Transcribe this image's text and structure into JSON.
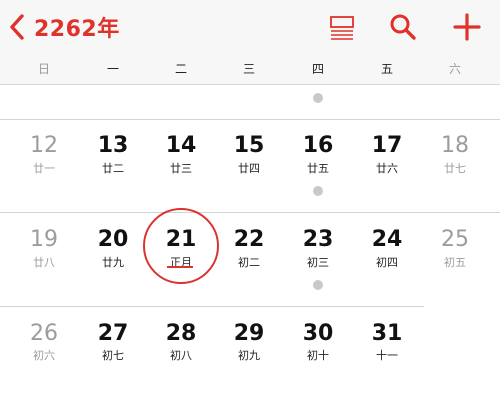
{
  "header": {
    "back_label": "2262年",
    "icons": {
      "list": "list-view-icon",
      "search": "search-icon",
      "add": "plus-icon"
    },
    "accent_color": "#e0312a"
  },
  "weekdays": [
    "日",
    "一",
    "二",
    "三",
    "四",
    "五",
    "六"
  ],
  "weeks": [
    {
      "days": [
        {
          "day": "12",
          "lunar": "廿一"
        },
        {
          "day": "13",
          "lunar": "廿二"
        },
        {
          "day": "14",
          "lunar": "廿三"
        },
        {
          "day": "15",
          "lunar": "廿四"
        },
        {
          "day": "16",
          "lunar": "廿五"
        },
        {
          "day": "17",
          "lunar": "廿六"
        },
        {
          "day": "18",
          "lunar": "廿七"
        }
      ]
    },
    {
      "days": [
        {
          "day": "19",
          "lunar": "廿八"
        },
        {
          "day": "20",
          "lunar": "廿九"
        },
        {
          "day": "21",
          "lunar": "正月",
          "today": true
        },
        {
          "day": "22",
          "lunar": "初二"
        },
        {
          "day": "23",
          "lunar": "初三"
        },
        {
          "day": "24",
          "lunar": "初四"
        },
        {
          "day": "25",
          "lunar": "初五"
        }
      ]
    },
    {
      "days": [
        {
          "day": "26",
          "lunar": "初六"
        },
        {
          "day": "27",
          "lunar": "初七"
        },
        {
          "day": "28",
          "lunar": "初八"
        },
        {
          "day": "29",
          "lunar": "初九"
        },
        {
          "day": "30",
          "lunar": "初十"
        },
        {
          "day": "31",
          "lunar": "十一"
        }
      ]
    }
  ],
  "event_dots": [
    "thursday-previous-week",
    "thursday-week-1",
    "thursday-week-2"
  ]
}
